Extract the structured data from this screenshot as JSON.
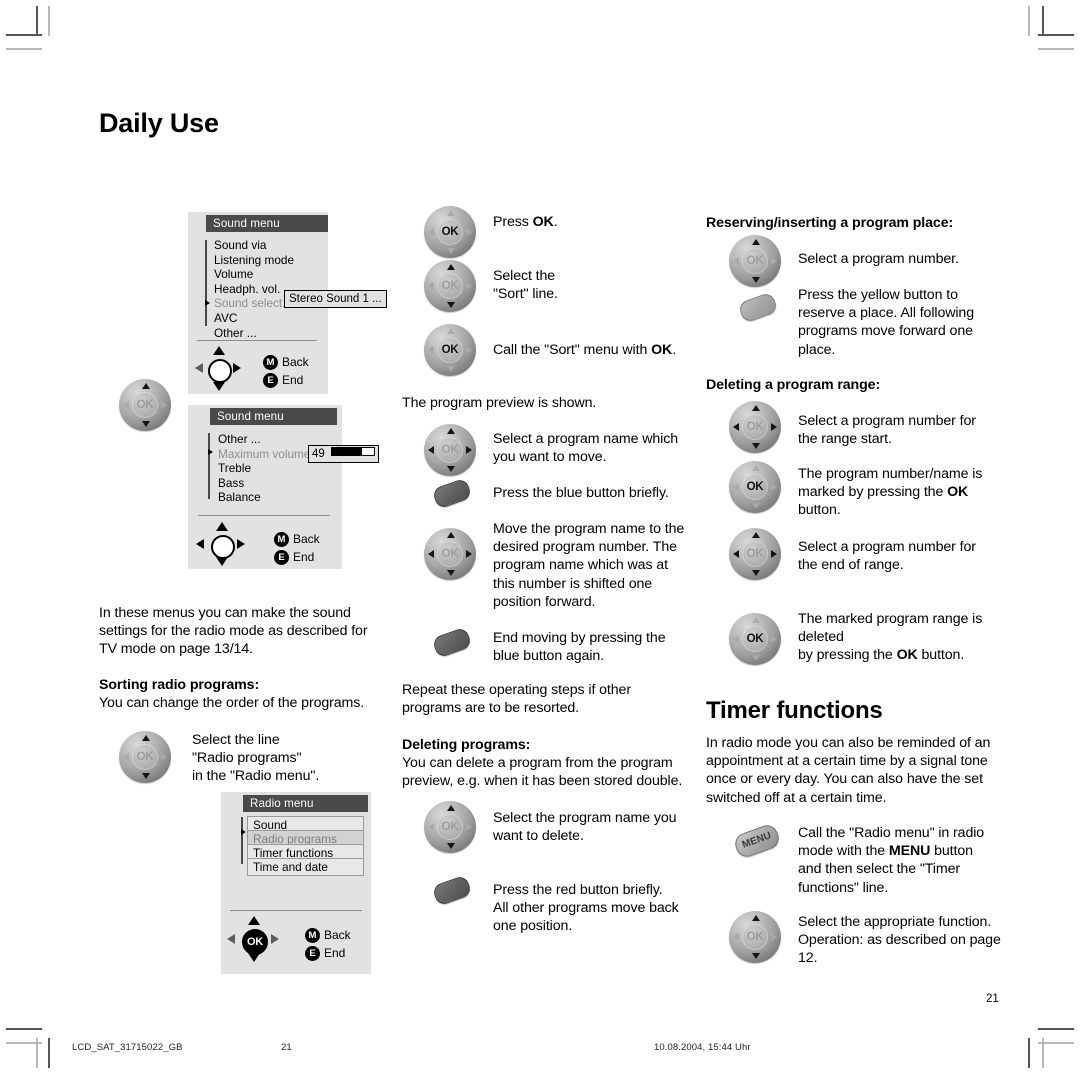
{
  "page": {
    "title": "Daily Use",
    "page_number": "21"
  },
  "footer": {
    "doc_id": "LCD_SAT_31715022_GB",
    "page": "21",
    "timestamp": "10.08.2004, 15:44 Uhr"
  },
  "osd": {
    "sound_menu_1": {
      "title": "Sound menu",
      "items": [
        {
          "label": "Sound via",
          "dim": false
        },
        {
          "label": "Listening mode",
          "dim": false
        },
        {
          "label": "Volume",
          "dim": false
        },
        {
          "label": "Headph. vol.",
          "dim": false
        },
        {
          "label": "Sound select.",
          "dim": true
        },
        {
          "label": "AVC",
          "dim": false
        },
        {
          "label": "Other ...",
          "dim": false
        }
      ],
      "value": "Stereo  Sound 1 ...",
      "back_key": "M",
      "back_label": "Back",
      "end_key": "E",
      "end_label": "End"
    },
    "sound_menu_2": {
      "title": "Sound menu",
      "items": [
        {
          "label": "Other ...",
          "dim": false
        },
        {
          "label": "Maximum volume",
          "dim": true
        },
        {
          "label": "Treble",
          "dim": false
        },
        {
          "label": "Bass",
          "dim": false
        },
        {
          "label": "Balance",
          "dim": false
        }
      ],
      "value": "49",
      "back_key": "M",
      "back_label": "Back",
      "end_key": "E",
      "end_label": "End"
    },
    "radio_menu": {
      "title": "Radio menu",
      "items": [
        {
          "label": "Sound",
          "selected": false
        },
        {
          "label": "Radio programs",
          "selected": true
        },
        {
          "label": "Timer functions",
          "selected": false
        },
        {
          "label": "Time and date",
          "selected": false
        }
      ],
      "ok_label": "OK",
      "back_key": "M",
      "back_label": "Back",
      "end_key": "E",
      "end_label": "End"
    }
  },
  "col_left": {
    "para_1": "In these menus you can make the sound settings for the radio mode as described for TV mode on page 13/14.",
    "heading_sorting": "Sorting radio programs:",
    "para_2": "You can change the order of the programs.",
    "step_1": "Select the line\n\"Radio programs\"\nin the \"Radio menu\"."
  },
  "col_mid": {
    "step_press_ok_a": "Press ",
    "step_press_ok_b": "OK",
    "step_press_ok_c": ".",
    "step_select_sort": "Select the\n\"Sort\" line.",
    "step_call_sort_a": "Call the \"Sort\" menu with ",
    "step_call_sort_b": "OK",
    "step_call_sort_c": ".",
    "para_preview": "The program preview is shown.",
    "step_select_name": "Select a program name which you want to move.",
    "step_blue_briefly": "Press the blue button briefly.",
    "step_move_name": "Move the program name to the desired program number. The program name which was at this number is shifted one position forward.",
    "step_end_moving": "End moving by pressing the blue button again.",
    "para_repeat": "Repeat these operating steps if other programs are to be resorted.",
    "heading_deleting": "Deleting programs:",
    "para_deleting": "You can delete a program from the program preview, e.g. when it has been stored double.",
    "step_select_delete": "Select the program name you want to delete.",
    "step_red_briefly": "Press the red button briefly.\nAll other programs move back one position."
  },
  "col_right": {
    "heading_reserving": "Reserving/inserting a program place:",
    "step_select_number": "Select a program number.",
    "step_yellow": "Press the yellow button to reserve a place.\nAll following programs move forward one place.",
    "heading_deleting_range": "Deleting a program range:",
    "step_range_start": "Select a program number for the range start.",
    "step_marked_a": "The program number/name is marked by pressing the ",
    "step_marked_b": "OK",
    "step_marked_c": " button.",
    "step_range_end": " Select a program number for the end of range.",
    "step_deleted_a": "The marked program range is deleted",
    "step_deleted_b": "by pressing the ",
    "step_deleted_c": "OK",
    "step_deleted_d": " button.",
    "heading_timer": "Timer functions",
    "para_timer": "In radio mode you can also be reminded of an appointment at a certain time by a signal tone once or every day. You can also have the set switched off at a certain time.",
    "step_menu_a": "Call the \"Radio menu\" in radio mode with the ",
    "step_menu_b": "MENU",
    "step_menu_c": " button and then select the \"Timer functions\" line.",
    "step_function": "Select the appropriate function.\nOperation: as described on page 12.",
    "menu_button_label": "MENU"
  },
  "icons": {
    "ok_label": "OK"
  },
  "colors": {
    "osd_bg": "#e2e2e2",
    "osd_title_bg": "#4a4a4a",
    "key_dark": "#5f5f5f",
    "key_light": "#a4a4a4"
  }
}
